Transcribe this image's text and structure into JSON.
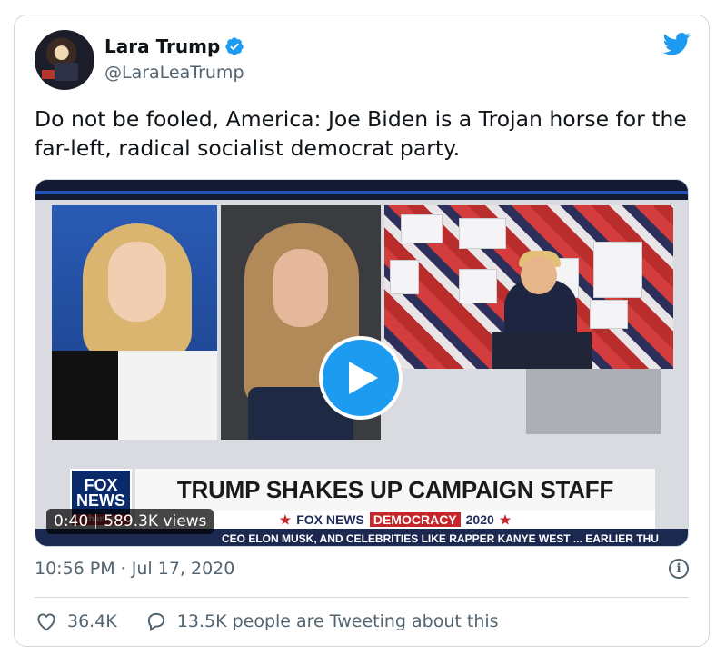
{
  "tweet": {
    "author_name": "Lara Trump",
    "author_handle": "@LaraLeaTrump",
    "verified": true,
    "text": "Do not be fooled, America: Joe Biden is a Trojan horse for the far-left, radical socialist democrat party.",
    "timestamp": "10:56 PM · Jul 17, 2020"
  },
  "media": {
    "type": "video",
    "duration": "0:40",
    "views": "589.3K views",
    "headline": "TRUMP SHAKES UP CAMPAIGN STAFF",
    "network_logo_line1": "FOX",
    "network_logo_line2": "NEWS",
    "network_logo_channel": "channel",
    "subchyron_brand": "FOX NEWS",
    "subchyron_section": "DEMOCRACY",
    "subchyron_year": "2020",
    "ticker_text": "CEO ELON MUSK, AND CELEBRITIES LIKE RAPPER KANYE WEST ...   EARLIER THU"
  },
  "actions": {
    "likes": "36.4K",
    "conversation": "13.5K people are Tweeting about this"
  },
  "colors": {
    "twitter_blue": "#1d9bf0",
    "text_primary": "#0f1419",
    "text_secondary": "#536471",
    "border": "#cfd9de"
  },
  "icons": [
    "twitter-bird-icon",
    "verified-badge-icon",
    "play-icon",
    "info-icon",
    "heart-icon",
    "reply-bubble-icon"
  ]
}
